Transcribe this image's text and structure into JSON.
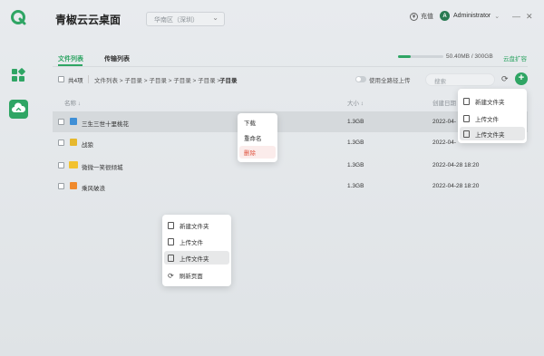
{
  "app": {
    "title": "青椒云云桌面"
  },
  "region": {
    "value": "华南区（深圳）"
  },
  "header": {
    "recharge_label": "充值",
    "user_initial": "A",
    "user_name": "Administrator"
  },
  "tabs": [
    {
      "label": "文件列表",
      "active": true
    },
    {
      "label": "传输列表",
      "active": false
    }
  ],
  "storage": {
    "text": "50.40MB / 300GB",
    "used_fraction": 0.28,
    "expand_label": "云盘扩容"
  },
  "toolbar": {
    "count_label": "共4项",
    "breadcrumb": "文件列表 > 子目录 > 子目录 > 子目录 > 子目录 > ",
    "breadcrumb_current": "子目录",
    "full_path_label": "使用全路径上传",
    "search_placeholder": "搜索"
  },
  "table": {
    "headers": {
      "name": "名称 ↓",
      "size": "大小 ↕",
      "created": "创建日期 ↕"
    },
    "rows": [
      {
        "name": "三生三世十里桃花",
        "size": "1.3GB",
        "created": "2022-04-",
        "icon": "image-file-icon"
      },
      {
        "name": "战狼",
        "size": "1.3GB",
        "created": "2022-04-",
        "icon": "archive-file-icon"
      },
      {
        "name": "微微一笑很倾城",
        "size": "1.3GB",
        "created": "2022-04-28 18:20",
        "icon": "folder-icon"
      },
      {
        "name": "乘风破浪",
        "size": "1.3GB",
        "created": "2022-04-28 18:20",
        "icon": "audio-file-icon"
      }
    ]
  },
  "row_context_menu": {
    "items": [
      "下载",
      "重命名",
      "删除"
    ]
  },
  "add_menu": {
    "items": [
      "新建文件夹",
      "上传文件",
      "上传文件夹"
    ]
  },
  "blank_context_menu": {
    "items": [
      "新建文件夹",
      "上传文件",
      "上传文件夹",
      "刷新页面"
    ]
  },
  "colors": {
    "accent": "#2fa564",
    "danger": "#e0533f"
  }
}
